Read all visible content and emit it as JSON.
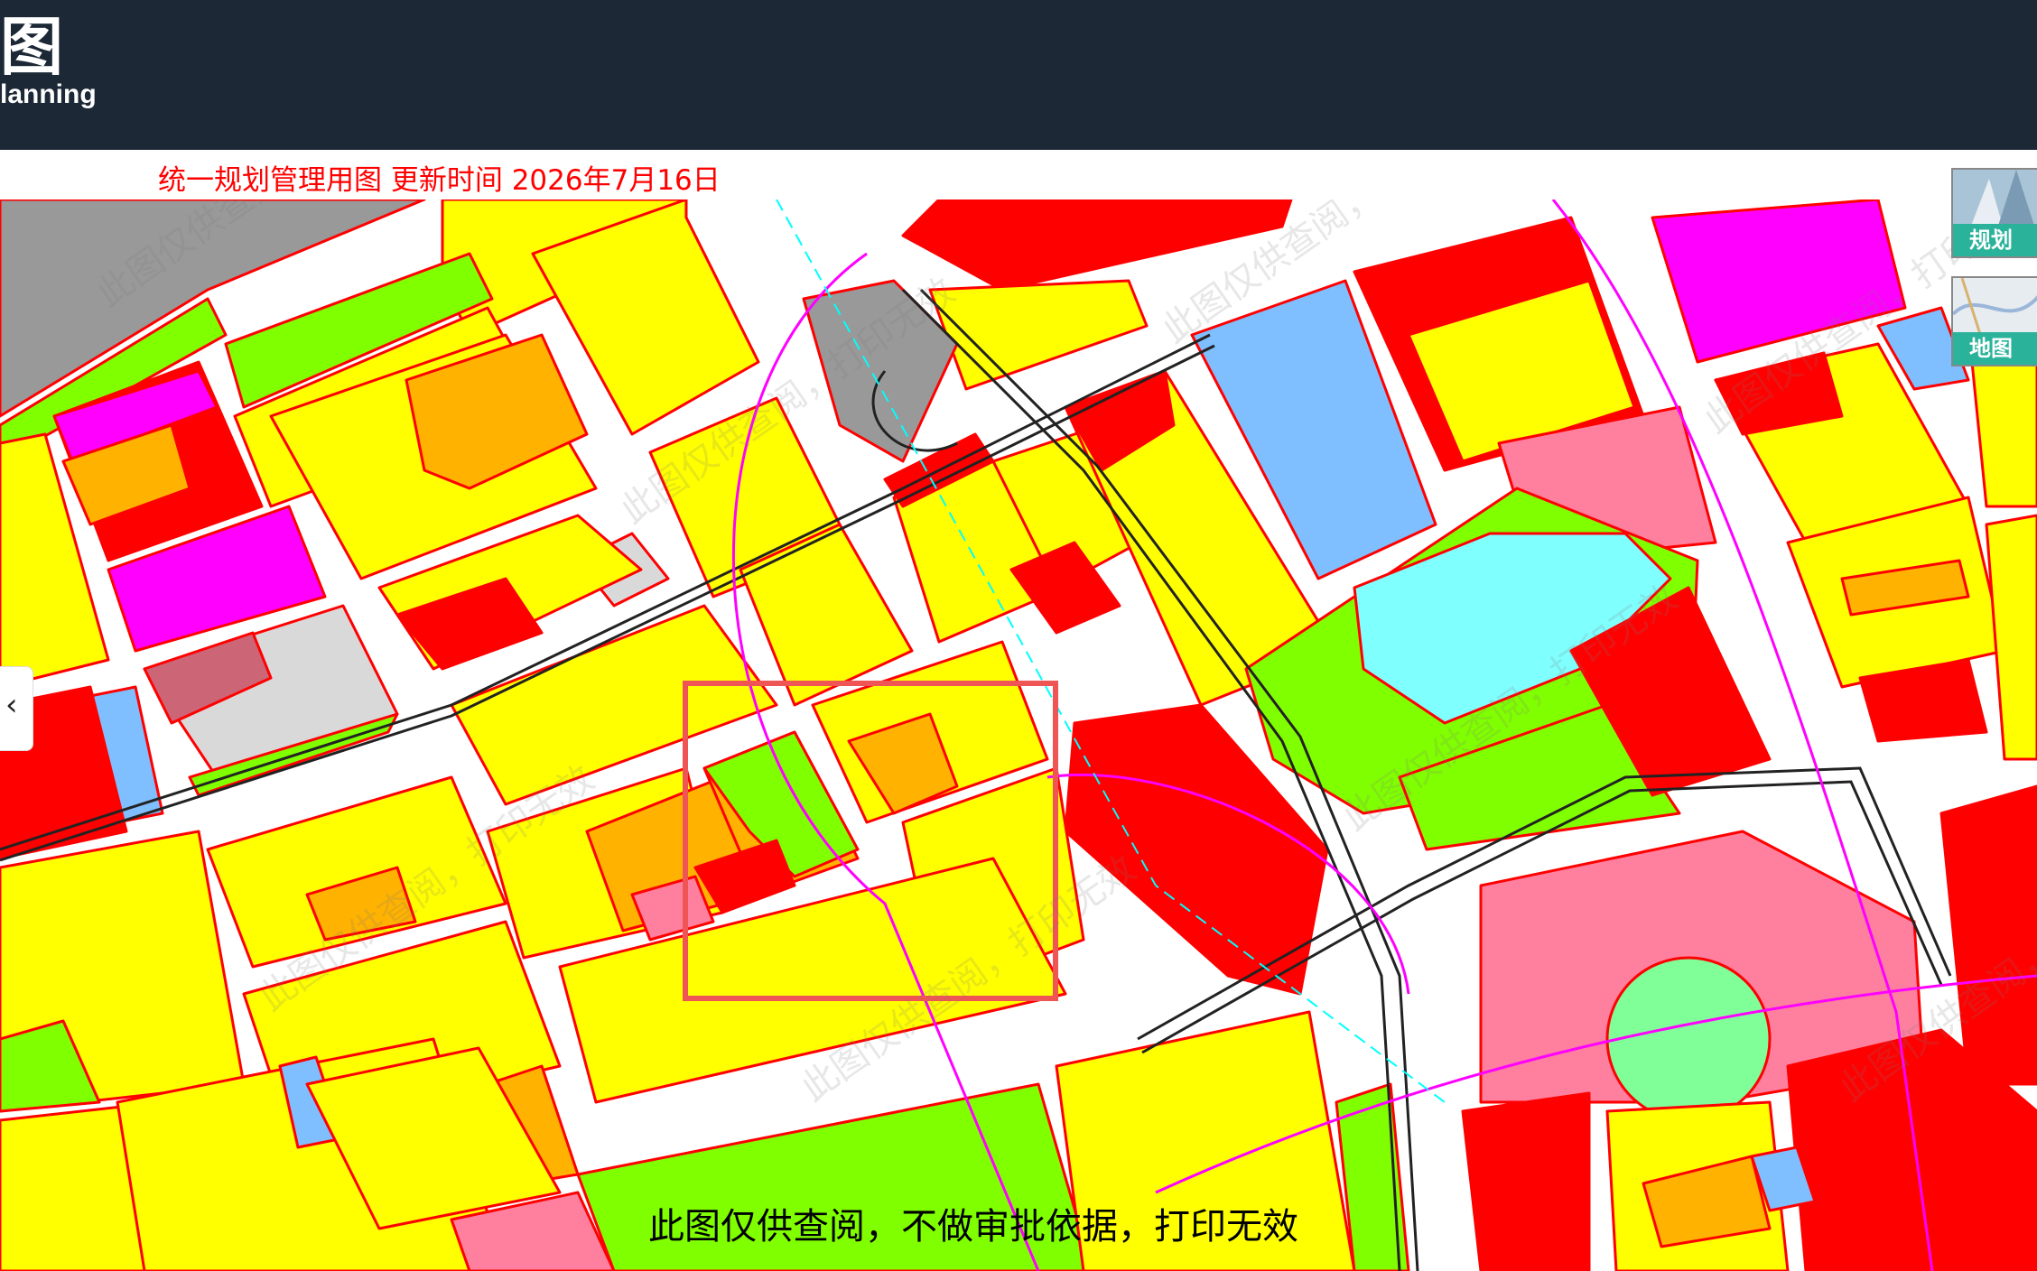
{
  "header": {
    "title_glyph": "图",
    "subtitle": "lanning"
  },
  "infobar": {
    "text": "统一规划管理用图 更新时间 2026年7月16日"
  },
  "map": {
    "disclaimer": "此图仅供查阅，不做审批依据，打印无效",
    "watermark": "此图仅供查阅，打印无效"
  },
  "layers": {
    "plan_label": "规划",
    "map_label": "地图"
  },
  "controls": {
    "collapse_glyph": "‹"
  },
  "colors": {
    "residential": "#ffff00",
    "commercial": "#ff0000",
    "green_space": "#80ff00",
    "water": "#80ffff",
    "education": "#ffb300",
    "industrial": "#ff00ff",
    "pink_zone": "#ff7f9f",
    "storage": "#999999",
    "blue_zone": "#80bfff",
    "light_grey": "#d9d9d9",
    "header_bg": "#1c2836",
    "layer_label_bg": "#2ab39a"
  }
}
